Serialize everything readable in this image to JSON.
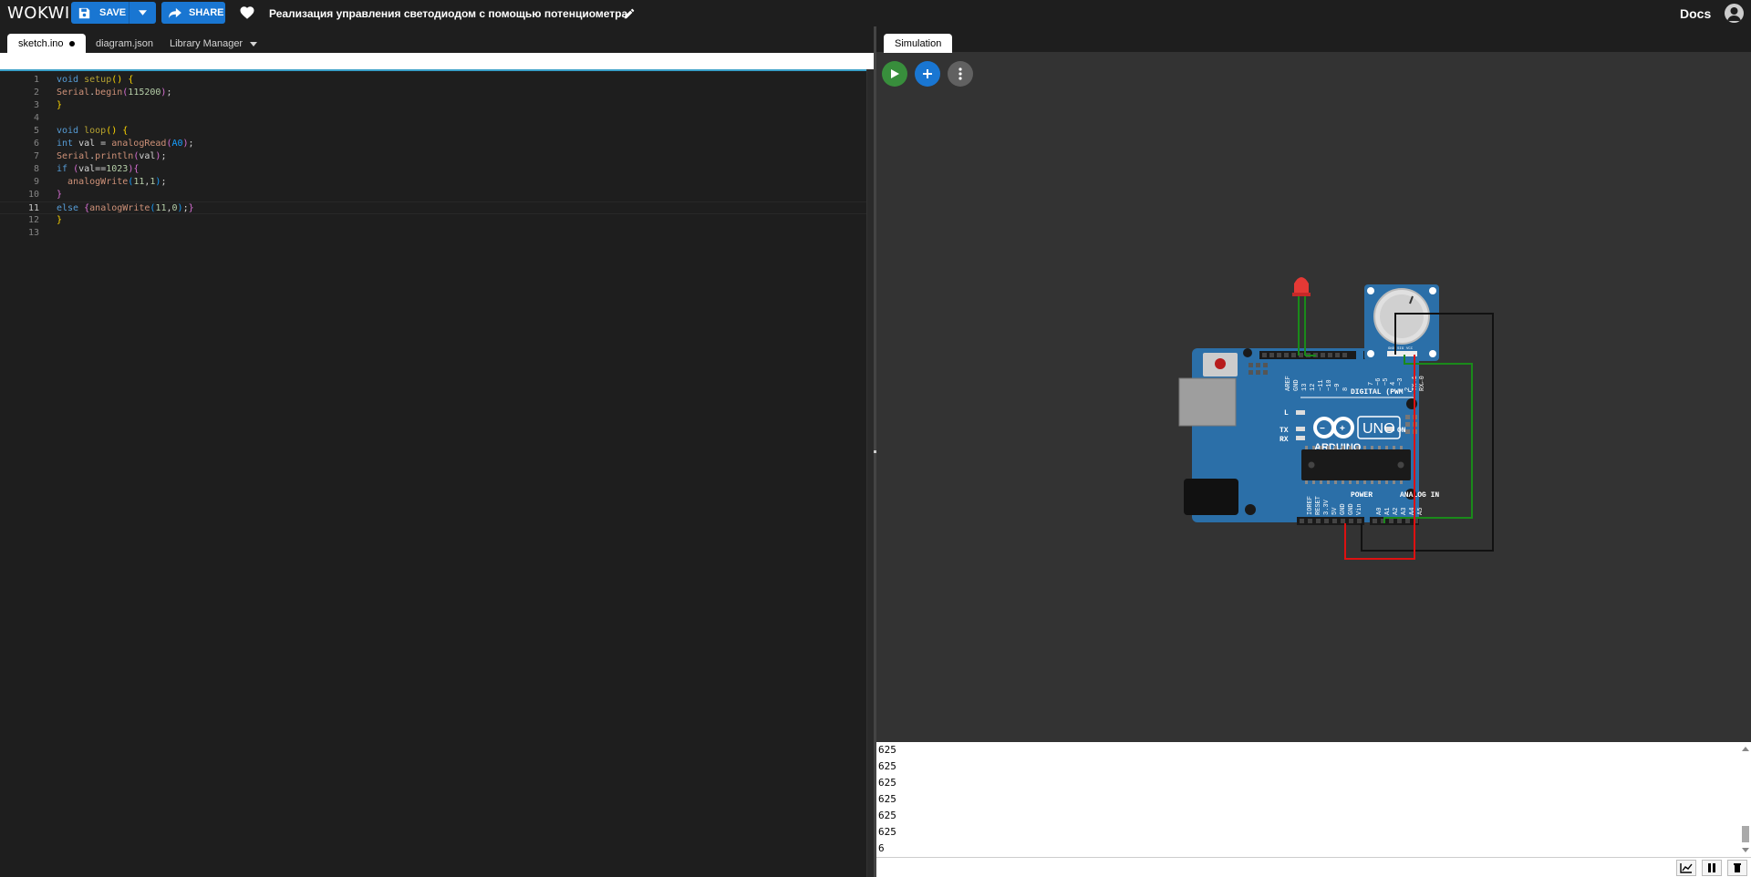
{
  "app": {
    "logo": "WOKWI",
    "save_label": "SAVE",
    "share_label": "SHARE",
    "project_title": "Реализация управления светодиодом с помощью потенциометра",
    "docs_label": "Docs"
  },
  "editor": {
    "tabs": [
      {
        "label": "sketch.ino",
        "active": true,
        "unsaved": true
      },
      {
        "label": "diagram.json",
        "active": false
      },
      {
        "label": "Library Manager",
        "active": false
      }
    ],
    "lines": [
      {
        "n": "1",
        "text": "void setup() {"
      },
      {
        "n": "2",
        "text": "Serial.begin(115200);"
      },
      {
        "n": "3",
        "text": "}"
      },
      {
        "n": "4",
        "text": ""
      },
      {
        "n": "5",
        "text": "void loop() {"
      },
      {
        "n": "6",
        "text": "int val = analogRead(A0);"
      },
      {
        "n": "7",
        "text": "Serial.println(val);"
      },
      {
        "n": "8",
        "text": "if (val==1023){"
      },
      {
        "n": "9",
        "text": "  analogWrite(11,1);"
      },
      {
        "n": "10",
        "text": "}"
      },
      {
        "n": "11",
        "text": "else {analogWrite(11,0);}"
      },
      {
        "n": "12",
        "text": "}"
      },
      {
        "n": "13",
        "text": ""
      }
    ],
    "current_line": "11"
  },
  "simulation": {
    "tab_label": "Simulation",
    "board": {
      "labels": {
        "aref": "AREF",
        "gnd": "GND",
        "p13": "13",
        "p12": "12",
        "p11": "~11",
        "p10": "~10",
        "p9": "~9",
        "p8": "8",
        "p7": "7",
        "p6": "~6",
        "p5": "~5",
        "p4": "4",
        "p3": "~3",
        "p2": "2",
        "tx1": "TX→1",
        "rx0": "RX←0",
        "digital": "DIGITAL (PWM ~)",
        "l": "L",
        "tx": "TX",
        "rx": "RX",
        "on": "ON",
        "uno": "UNO",
        "arduino": "ARDUINO",
        "ioref": "IOREF",
        "reset": "RESET",
        "v33": "3.3V",
        "v5": "5V",
        "gnd1": "GND",
        "gnd2": "GND",
        "vin": "Vin",
        "power": "POWER",
        "analog_in": "ANALOG IN",
        "a0": "A0",
        "a1": "A1",
        "a2": "A2",
        "a3": "A3",
        "a4": "A4",
        "a5": "A5"
      },
      "pot_labels": {
        "gnd": "GND",
        "sig": "SIG",
        "vcc": "VCC"
      },
      "colors": {
        "board": "#2b6fa8",
        "board_dark": "#1f5a8c",
        "wire_green": "#1a8a1a",
        "wire_red": "#d11",
        "wire_black": "#111",
        "led": "#e53935"
      }
    }
  },
  "serial_monitor": {
    "lines": [
      "625",
      "625",
      "625",
      "625",
      "625",
      "625",
      "625",
      "6"
    ]
  }
}
